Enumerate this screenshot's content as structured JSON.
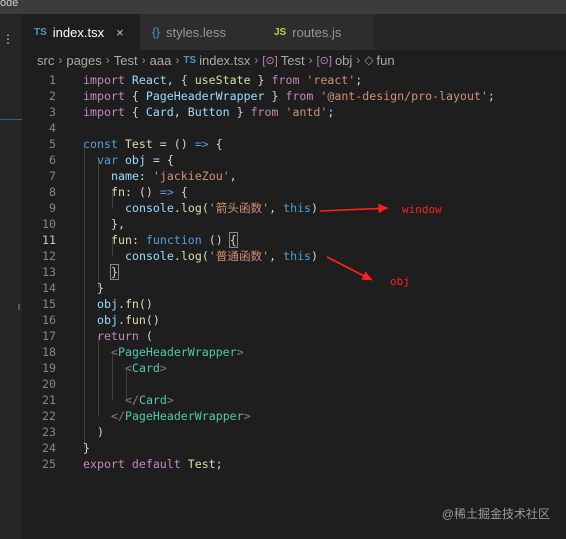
{
  "titlebar": {
    "text": "ode"
  },
  "tabs": [
    {
      "icon": "TS",
      "label": "index.tsx",
      "close": "×",
      "active": true
    },
    {
      "icon": "{}",
      "label": "styles.less",
      "active": false
    },
    {
      "icon": "JS",
      "label": "routes.js",
      "active": false
    }
  ],
  "breadcrumb": {
    "parts": [
      "src",
      "pages",
      "Test",
      "aaa"
    ],
    "file": "index.tsx",
    "file_icon": "TS",
    "symbols": [
      "Test",
      "obj"
    ],
    "method": "fun"
  },
  "gutter": [
    "1",
    "2",
    "3",
    "4",
    "5",
    "6",
    "7",
    "8",
    "9",
    "10",
    "11",
    "12",
    "13",
    "14",
    "15",
    "16",
    "17",
    "18",
    "19",
    "20",
    "21",
    "22",
    "23",
    "24",
    "25"
  ],
  "current_line": "11",
  "code": {
    "l1": [
      "import",
      " React, { ",
      "useState",
      " } ",
      "from",
      " ",
      "'react'",
      ";"
    ],
    "l2": [
      "import",
      " { ",
      "PageHeaderWrapper",
      " } ",
      "from",
      " ",
      "'@ant-design/pro-layout'",
      ";"
    ],
    "l3": [
      "import",
      " { ",
      "Card",
      ", ",
      "Button",
      " } ",
      "from",
      " ",
      "'antd'",
      ";"
    ],
    "l5": [
      "const",
      " ",
      "Test",
      " = () ",
      "=>",
      " {"
    ],
    "l6": [
      "var",
      " ",
      "obj",
      " = {"
    ],
    "l7": [
      "name",
      ": ",
      "'jackieZou'",
      ","
    ],
    "l8": [
      "fn",
      ": () ",
      "=>",
      " {"
    ],
    "l9": [
      "console",
      ".",
      "log",
      "(",
      "'箭头函数'",
      ", ",
      "this",
      ")"
    ],
    "l10": [
      "},"
    ],
    "l11": [
      "fun",
      ": ",
      "function",
      " () ",
      "{"
    ],
    "l12": [
      "console",
      ".",
      "log",
      "(",
      "'普通函数'",
      ", ",
      "this",
      ")"
    ],
    "l13": [
      "}"
    ],
    "l14": [
      "}"
    ],
    "l15": [
      "obj",
      ".",
      "fn",
      "()"
    ],
    "l16": [
      "obj",
      ".",
      "fun",
      "()"
    ],
    "l17": [
      "return",
      " ("
    ],
    "l18": [
      "<",
      "PageHeaderWrapper",
      ">"
    ],
    "l19": [
      "<",
      "Card",
      ">"
    ],
    "l21": [
      "</",
      "Card",
      ">"
    ],
    "l22": [
      "</",
      "PageHeaderWrapper",
      ">"
    ],
    "l23": [
      ")"
    ],
    "l24": [
      "}"
    ],
    "l25": [
      "export",
      " ",
      "default",
      " ",
      "Test",
      ";"
    ]
  },
  "annotations": {
    "window_label": "window",
    "obj_label": "obj",
    "arrow_color": "#ff2020"
  },
  "watermark": "@稀土掘金技术社区"
}
